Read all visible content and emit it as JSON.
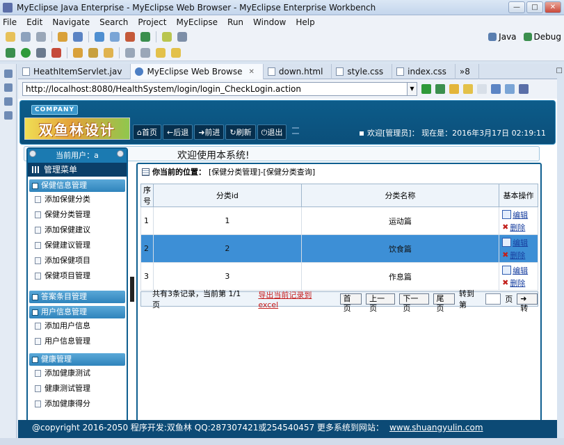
{
  "window": {
    "title": "MyEclipse Java Enterprise - MyEclipse Web Browser - MyEclipse Enterprise Workbench"
  },
  "menu": [
    "File",
    "Edit",
    "Navigate",
    "Search",
    "Project",
    "MyEclipse",
    "Run",
    "Window",
    "Help"
  ],
  "perspectives": {
    "java": "Java",
    "debug": "Debug"
  },
  "tabs": [
    {
      "label": "HeathItemServlet.jav"
    },
    {
      "label": "MyEclipse Web Browse"
    },
    {
      "label": "down.html"
    },
    {
      "label": "style.css"
    },
    {
      "label": "index.css"
    }
  ],
  "tab_overflow": "»8",
  "address": {
    "url": "http://localhost:8080/HealthSystem/login/login_CheckLogin.action"
  },
  "site": {
    "company": "COMPANY",
    "logo": "双鱼林设计",
    "nav": [
      "首页",
      "后退",
      "前进",
      "刷新",
      "退出"
    ],
    "welcome": "欢迎[管理员]：  现在是：2016年3月17日 02:19:11",
    "subheader": "欢迎使用本系统!"
  },
  "leftmenu": {
    "current_user": "当前用户：a",
    "title": "管理菜单",
    "groups": [
      {
        "title": "保健信息管理",
        "items": [
          "添加保健分类",
          "保健分类管理",
          "添加保健建议",
          "保健建议管理",
          "添加保健项目",
          "保健项目管理"
        ]
      },
      {
        "title": "答案条目管理",
        "items": []
      },
      {
        "title": "用户信息管理",
        "items": [
          "添加用户信息",
          "用户信息管理"
        ]
      },
      {
        "title": "健康管理",
        "items": [
          "添加健康测试",
          "健康测试管理",
          "添加健康得分"
        ]
      }
    ]
  },
  "main": {
    "location_label": "你当前的位置：",
    "location_path": "[保健分类管理]-[保健分类查询]",
    "columns": [
      "序号",
      "分类id",
      "分类名称",
      "基本操作"
    ],
    "rows": [
      {
        "idx": "1",
        "id": "1",
        "name": "运动篇"
      },
      {
        "idx": "2",
        "id": "2",
        "name": "饮食篇"
      },
      {
        "idx": "3",
        "id": "3",
        "name": "作息篇"
      }
    ],
    "edit_label": "编辑",
    "delete_label": "删除",
    "pager": {
      "summary": "共有3条记录，当前第 1/1 页",
      "export": "导出当前记录到excel",
      "first": "首页",
      "prev": "上一页",
      "next": "下一页",
      "last": "尾页",
      "goto_label": "转到第",
      "page_unit": "页",
      "go": "转"
    }
  },
  "footer": {
    "text": "@copyright 2016-2050  程序开发:双鱼林  QQ:287307421或254540457  更多系统到网站：",
    "link": "www.shuangyulin.com"
  }
}
